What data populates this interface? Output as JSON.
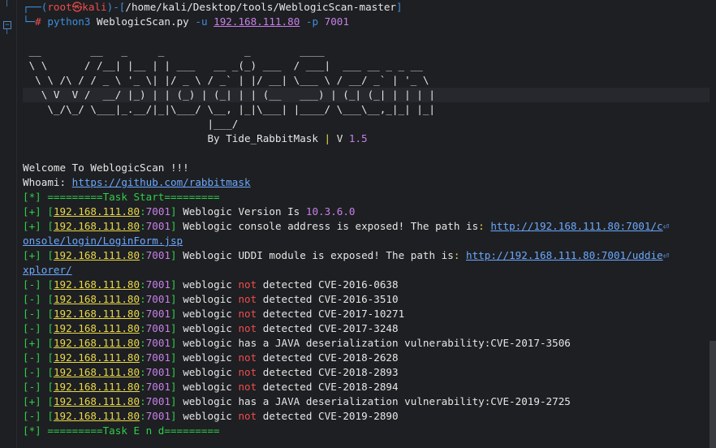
{
  "prompt": {
    "user": "root",
    "host": "kali",
    "path": "/home/kali/Desktop/tools/WeblogicScan-master",
    "cmd": "python3",
    "script": "WeblogicScan.py",
    "flag_u": "-u",
    "ip": "192.168.111.80",
    "flag_p": "-p",
    "port": "7001"
  },
  "banner": [
    " __        __   _     _             _        ____",
    " \\ \\      / /__| |__ | | ___   __ _(_) ___  / ___|  ___ __ _ _ __",
    "  \\ \\ /\\ / / _ \\ '_ \\| |/ _ \\ / _` | |/ __| \\___ \\ / __/ _` | '_ \\",
    "   \\ V  V /  __/ |_) | | (_) | (_| | | (__   ___) | (_| (_| | | | |",
    "    \\_/\\_/ \\___|_.__/|_|\\___/ \\__, |_|\\___| |____/ \\___\\__,_|_| |_|",
    "                              |___/"
  ],
  "byline": {
    "prefix": "                              By Tide_RabbitMask ",
    "sep": "|",
    "v": " V ",
    "version": "1.5"
  },
  "welcome": "Welcome To WeblogicScan !!!",
  "whoami_label": "Whoami: ",
  "whoami_url": "https://github.com/rabbitmask",
  "task_start": "[*] =========Task Start=========",
  "task_end": "[*] =========Task E n d=========",
  "target_ip": "192.168.111.80",
  "target_port": "7001",
  "version_line": {
    "tag": "[+] ",
    "text": " Weblogic Version Is ",
    "version": "10.3.6.0"
  },
  "console_line": {
    "tag": "[+] ",
    "text": " Weblogic console address is exposed! The path is",
    "colon": ": ",
    "url1": "http://192.168.111.80:7001/c",
    "url2": "onsole/login/LoginForm.jsp"
  },
  "uddi_line": {
    "tag": "[+] ",
    "text": " Weblogic UDDI module is exposed! The path is",
    "colon": ": ",
    "url1": "http://192.168.111.80:7001/uddie",
    "url2": "xplorer/"
  },
  "wrap_glyph": "⏎",
  "cve_lines": [
    {
      "tag": "[-] ",
      "pre": " weblogic ",
      "mid": "not",
      "post": " detected CVE-2016-0638",
      "positive": false
    },
    {
      "tag": "[-] ",
      "pre": " weblogic ",
      "mid": "not",
      "post": " detected CVE-2016-3510",
      "positive": false
    },
    {
      "tag": "[-] ",
      "pre": " weblogic ",
      "mid": "not",
      "post": " detected CVE-2017-10271",
      "positive": false
    },
    {
      "tag": "[-] ",
      "pre": " weblogic ",
      "mid": "not",
      "post": " detected CVE-2017-3248",
      "positive": false
    },
    {
      "tag": "[+] ",
      "pre": " weblogic has a JAVA deserialization vulnerability:CVE-2017-3506",
      "mid": "",
      "post": "",
      "positive": true
    },
    {
      "tag": "[-] ",
      "pre": " weblogic ",
      "mid": "not",
      "post": " detected CVE-2018-2628",
      "positive": false
    },
    {
      "tag": "[-] ",
      "pre": " weblogic ",
      "mid": "not",
      "post": " detected CVE-2018-2893",
      "positive": false
    },
    {
      "tag": "[-] ",
      "pre": " weblogic ",
      "mid": "not",
      "post": " detected CVE-2018-2894",
      "positive": false
    },
    {
      "tag": "[+] ",
      "pre": " weblogic has a JAVA deserialization vulnerability:CVE-2019-2725",
      "mid": "",
      "post": "",
      "positive": true
    },
    {
      "tag": "[-] ",
      "pre": " weblogic ",
      "mid": "not",
      "post": " detected CVE-2019-2890",
      "positive": false
    }
  ],
  "colors": {
    "background": "#1e1f22",
    "prompt_blue": "#3d8fe0",
    "prompt_red": "#ef4d4d",
    "ip_yellow": "#e8d84a",
    "port_purple": "#c680e8",
    "status_green": "#2ecf4a"
  }
}
